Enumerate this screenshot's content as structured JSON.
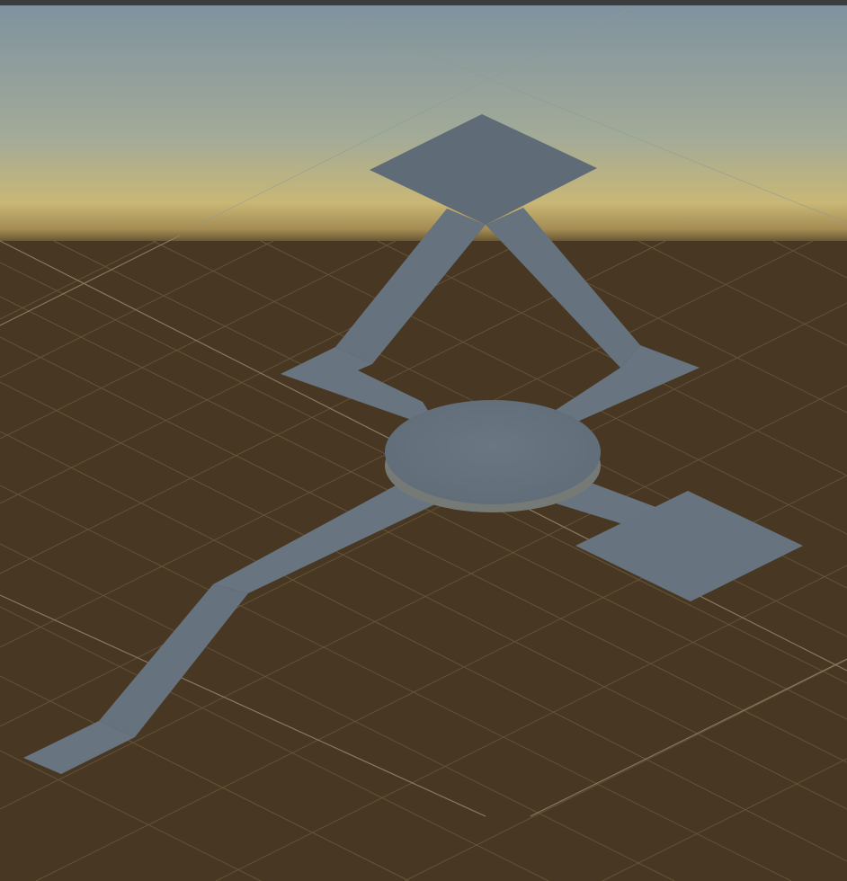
{
  "window": {
    "title": ""
  },
  "scene_view": {
    "sky_top_color": "#86979f",
    "sky_horizon_color": "#c9b776",
    "ground_color": "#483823",
    "grid_color": "#6b5a3e",
    "mesh_color": "#67737f",
    "mesh_shade_color": "#5b6672"
  },
  "icons": {
    "grid": "scene-grid",
    "mesh": "navmesh-geometry"
  }
}
